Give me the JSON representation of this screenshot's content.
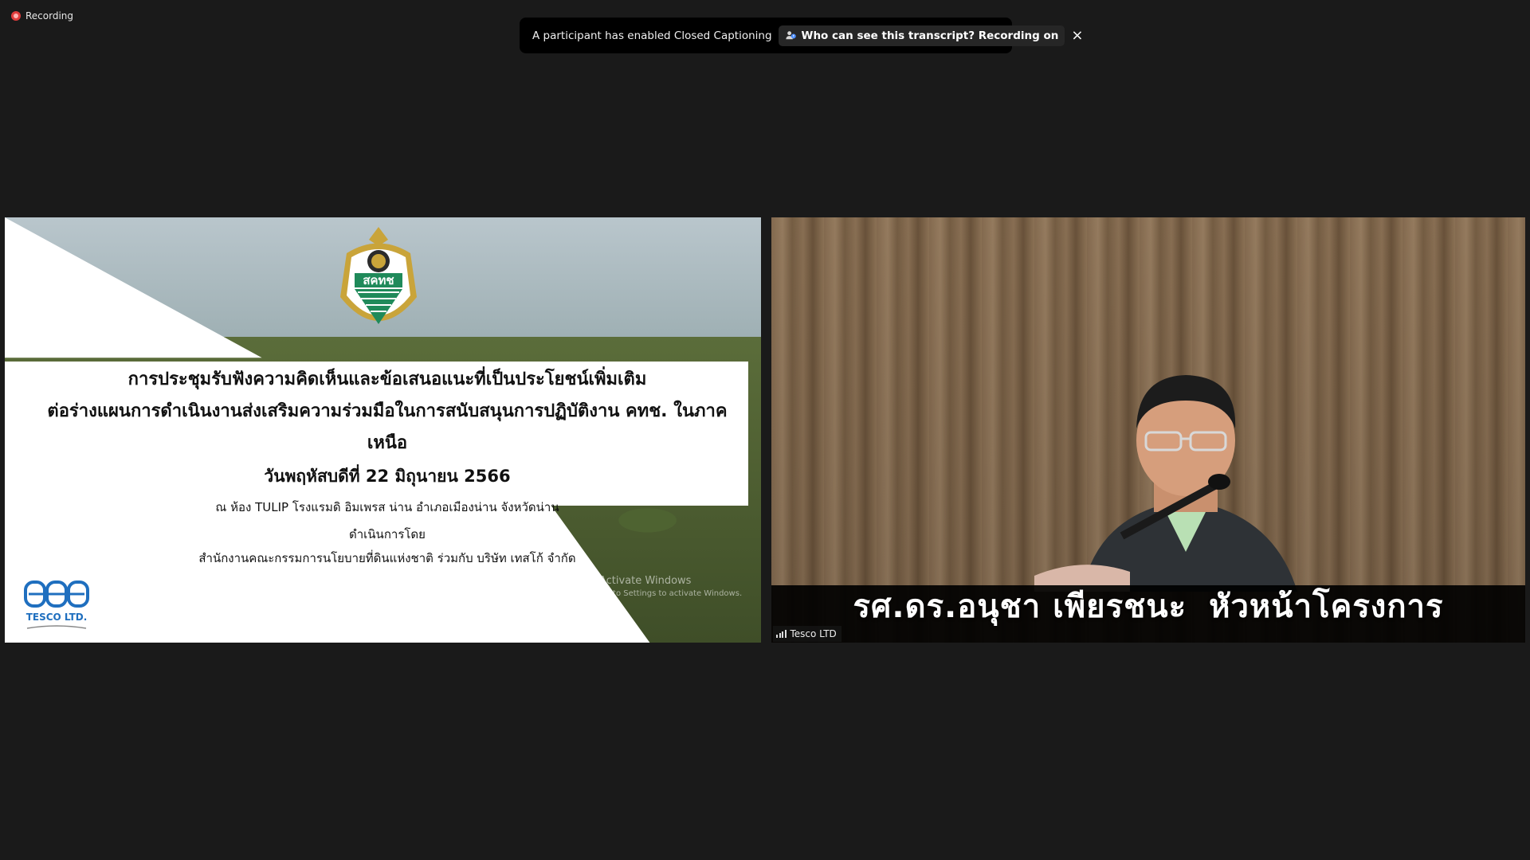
{
  "recording": {
    "label": "Recording"
  },
  "notification": {
    "message": "A participant has enabled Closed Captioning",
    "link_label": "Who can see this transcript? Recording on",
    "close_symbol": "×"
  },
  "shared_slide": {
    "title_line1": "การประชุมรับฟังความคิดเห็นและข้อเสนอแนะที่เป็นประโยชน์เพิ่มเติม",
    "title_line2": "ต่อร่างแผนการดำเนินงานส่งเสริมความร่วมมือในการสนับสนุนการปฏิบัติงาน คทช. ในภาคเหนือ",
    "date": "วันพฤหัสบดีที่ 22 มิถุนายน 2566",
    "venue": "ณ ห้อง TULIP โรงแรมดิ อิมเพรส น่าน อำเภอเมืองน่าน จังหวัดน่าน",
    "organized_by": "ดำเนินการโดย",
    "organizers": "สำนักงานคณะกรรมการนโยบายที่ดินแห่งชาติ ร่วมกับ บริษัท เทสโก้ จำกัด",
    "emblem_text": "สคทช",
    "logo_text": "TESCO LTD.",
    "watermark_title": "Activate Windows",
    "watermark_sub": "Go to Settings to activate Windows."
  },
  "speaker_video": {
    "name": "รศ.ดร.อนุชา เพียรชนะ",
    "role": "หัวหน้าโครงการ",
    "participant_name": "Tesco LTD"
  },
  "colors": {
    "background": "#1a1a1a",
    "toast": "#000000",
    "recording_red": "#e23c3c",
    "emblem_gold": "#c9a43a",
    "emblem_green": "#1f8a5a",
    "tesco_blue": "#1f6fbf"
  }
}
